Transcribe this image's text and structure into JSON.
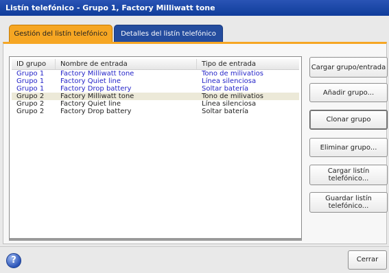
{
  "window": {
    "title": "Listín telefónico - Grupo 1, Factory Milliwatt tone"
  },
  "tabs": [
    {
      "label": "Gestión del listín telefónico",
      "active": true
    },
    {
      "label": "Detalles del listín telefónico",
      "active": false
    }
  ],
  "table": {
    "columns": [
      "ID grupo",
      "Nombre de entrada",
      "Tipo de entrada"
    ],
    "rows": [
      {
        "group": "Grupo 1",
        "name": "Factory Milliwatt tone",
        "type": "Tono de milivatios",
        "color": "blue"
      },
      {
        "group": "Grupo 1",
        "name": "Factory Quiet line",
        "type": "Línea silenciosa",
        "color": "blue"
      },
      {
        "group": "Grupo 1",
        "name": "Factory Drop battery",
        "type": "Soltar batería",
        "color": "blue"
      },
      {
        "group": "Grupo 2",
        "name": "Factory Milliwatt tone",
        "type": "Tono de milivatios",
        "color": "black",
        "selected": true
      },
      {
        "group": "Grupo 2",
        "name": "Factory Quiet line",
        "type": "Línea silenciosa",
        "color": "black"
      },
      {
        "group": "Grupo 2",
        "name": "Factory Drop battery",
        "type": "Soltar batería",
        "color": "black"
      }
    ]
  },
  "buttons": {
    "load_group_entry": "Cargar grupo/entrada",
    "add_group": "Añadir grupo...",
    "clone_group": "Clonar grupo",
    "delete_group": "Eliminar grupo...",
    "load_phonebook": "Cargar listín\ntelefónico...",
    "save_phonebook": "Guardar listín\ntelefónico..."
  },
  "footer": {
    "help_icon": "?",
    "close_label": "Cerrar"
  },
  "colors": {
    "title_bar": "#1a47a8",
    "active_tab": "#f6a623",
    "inactive_tab": "#244c9e",
    "group1_text": "#2323c8"
  }
}
